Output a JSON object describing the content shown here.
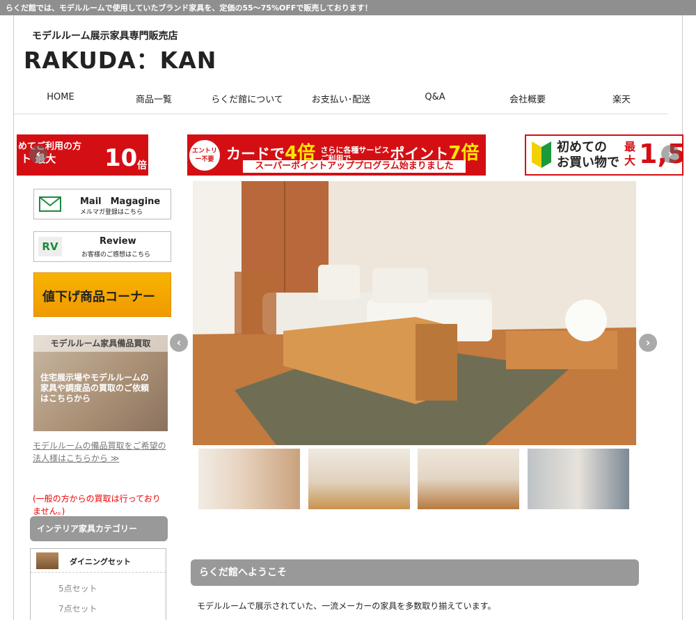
{
  "topbar": {
    "message": "らくだ館では、モデルルームで使用していたブランド家具を、定価の55～75%OFFで販売しております！"
  },
  "header": {
    "subtitle": "モデルルーム展示家具専門販売店",
    "logo": "RAKUDA：KAN"
  },
  "nav": {
    "items": [
      "HOME",
      "商品一覧",
      "らくだ館について",
      "お支払い･配送",
      "Q&A",
      "会社概要",
      "楽天"
    ]
  },
  "banners": {
    "b1": {
      "line1": "めてご利用の方",
      "line2": "ト 最大",
      "big": "10",
      "unit": "倍"
    },
    "b2": {
      "badge": "エントリー不要",
      "card": "カードで",
      "mult1": "4倍",
      "small": "さらに各種サービスご利用で",
      "point": "ポイント",
      "mult2": "7倍",
      "strip": "スーパーポイントアッププログラム始まりました"
    },
    "b3": {
      "line": "初めての\nお買い物で",
      "max": "最\n大",
      "big": "1,5"
    }
  },
  "arrows": {
    "prev": "‹",
    "next": "›"
  },
  "sidebar": {
    "mail": {
      "title": "Mail　Magagine",
      "sub": "メルマガ登録はこちら",
      "icon": "envelope-icon"
    },
    "review": {
      "title": "Review",
      "sub": "お客様のご感想はこちら",
      "icon_text": "RV"
    },
    "price_down": "値下げ商品コーナー",
    "kaitori": {
      "title": "モデルルーム家具備品買取",
      "body": "住宅展示場やモデルルームの\n家具や調度品の買取のご依頼\nはこちらから"
    },
    "link": "モデルルームの備品買取をご希望の\n法人様はこちらから ≫",
    "note": "(一般の方からの買取は行っておりません。)",
    "category_header": "インテリア家具カテゴリー",
    "category": {
      "name": "ダイニングセット",
      "subs": [
        "5点セット",
        "7点セット"
      ]
    }
  },
  "main": {
    "welcome": "らくだ館へようこそ",
    "intro": "モデルルームで展示されていた、一流メーカーの家具を多数取り揃えています。"
  },
  "colors": {
    "topbar": "#8f8f8f",
    "banner_red": "#d40f14",
    "price_down": "#f7b400",
    "header_gray": "#999999",
    "note_red": "#ee0000"
  }
}
